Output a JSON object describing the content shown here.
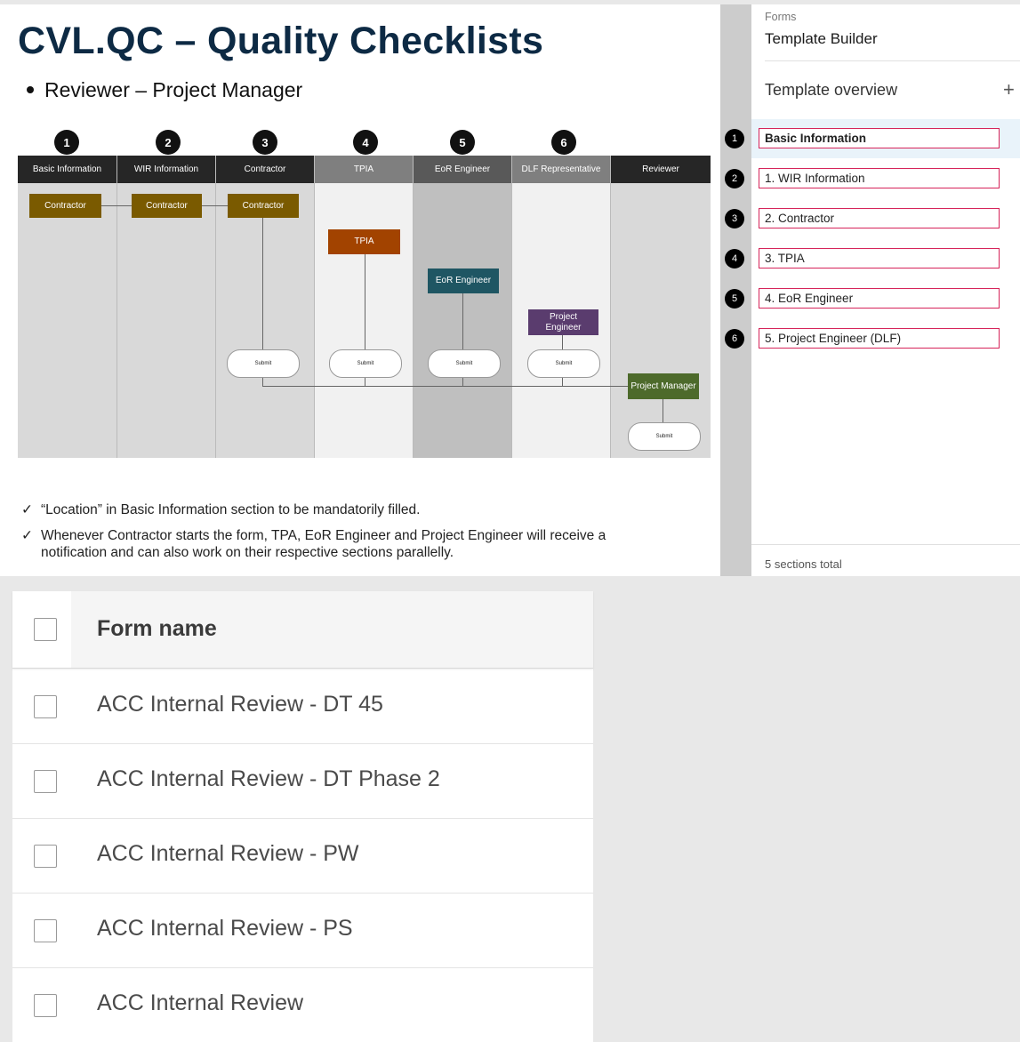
{
  "slide": {
    "title": "CVL.QC – Quality Checklists",
    "subtitle": "Reviewer – Project Manager",
    "notes": [
      "“Location” in Basic Information section to be mandatorily filled.",
      "Whenever Contractor starts the form, TPA, EoR Engineer and Project Engineer will receive a",
      "notification and can also work on their respective sections parallelly."
    ],
    "check_glyph": "✓"
  },
  "diagram": {
    "numbers": [
      "1",
      "2",
      "3",
      "4",
      "5",
      "6"
    ],
    "lanes": [
      "Basic Information",
      "WIR Information",
      "Contractor",
      "TPIA",
      "EoR Engineer",
      "DLF Representative",
      "Reviewer"
    ],
    "boxes": {
      "contractor": "Contractor",
      "tpia": "TPIA",
      "eor": "EoR Engineer",
      "project_engineer": "Project Engineer",
      "project_manager": "Project Manager"
    },
    "submit": "Submit",
    "colors": {
      "contractor": "#7a5a00",
      "tpia": "#a24300",
      "eor": "#1f5663",
      "project_engineer": "#5a3c6e",
      "project_manager": "#4d6a2b"
    }
  },
  "panel": {
    "breadcrumb": "Forms",
    "title": "Template Builder",
    "overview": "Template overview",
    "add_glyph": "+",
    "sections": [
      {
        "num": "1",
        "label": "Basic Information"
      },
      {
        "num": "2",
        "label": "1. WIR Information"
      },
      {
        "num": "3",
        "label": "2. Contractor"
      },
      {
        "num": "4",
        "label": "3. TPIA"
      },
      {
        "num": "5",
        "label": "4. EoR Engineer"
      },
      {
        "num": "6",
        "label": "5. Project Engineer (DLF)"
      }
    ],
    "total": "5 sections total"
  },
  "form_list": {
    "header": "Form name",
    "rows": [
      "ACC Internal Review - DT 45",
      "ACC Internal Review - DT Phase 2",
      "ACC Internal Review - PW",
      "ACC Internal Review - PS",
      "ACC Internal Review"
    ]
  }
}
